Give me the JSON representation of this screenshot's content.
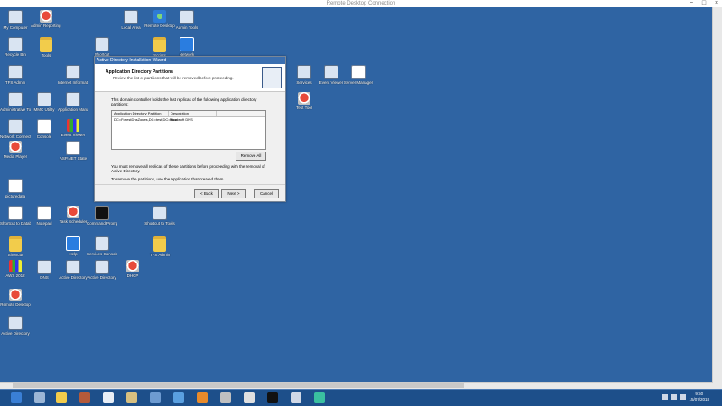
{
  "window": {
    "title": "Remote Desktop Connection",
    "controls": [
      "−",
      "□",
      "×"
    ]
  },
  "desktop": {
    "icons": [
      {
        "label": "My Computer",
        "glyph": "g-app"
      },
      {
        "label": "Admin Reporting Tool",
        "glyph": "g-red"
      },
      {
        "label": "Local Area",
        "glyph": "g-app"
      },
      {
        "label": "Remote Desktop",
        "glyph": "g-globe"
      },
      {
        "label": "Admin Tools",
        "glyph": "g-app"
      },
      {
        "label": "Recycle Bin",
        "glyph": "g-app"
      },
      {
        "label": "Tools",
        "glyph": "g-folder"
      },
      {
        "label": "Shortcut",
        "glyph": "g-app"
      },
      {
        "label": "Scripts",
        "glyph": "g-folder"
      },
      {
        "label": "Network",
        "glyph": "g-blue"
      },
      {
        "label": "TFS Admin",
        "glyph": "g-app"
      },
      {
        "label": "Internet Information",
        "glyph": "g-app"
      },
      {
        "label": "Service",
        "glyph": "g-purple"
      },
      {
        "label": "Administrative Tools",
        "glyph": "g-app"
      },
      {
        "label": "MMC Utility",
        "glyph": "g-app"
      },
      {
        "label": "Application Manager",
        "glyph": "g-app"
      },
      {
        "label": "Network Connections",
        "glyph": "g-app"
      },
      {
        "label": "Console",
        "glyph": "g-doc"
      },
      {
        "label": "Event Viewer",
        "glyph": "g-multi"
      },
      {
        "label": "Media Player",
        "glyph": "g-red"
      },
      {
        "label": "ASP.NET State",
        "glyph": "g-doc"
      },
      {
        "label": "picturedata",
        "glyph": "g-doc"
      },
      {
        "label": "Shortcut to Database",
        "glyph": "g-doc"
      },
      {
        "label": "Notepad",
        "glyph": "g-doc"
      },
      {
        "label": "Task Scheduler",
        "glyph": "g-red"
      },
      {
        "label": "Command Prompt",
        "glyph": "g-black"
      },
      {
        "label": "Shortcut to Tools",
        "glyph": "g-app"
      },
      {
        "label": "Shortcut",
        "glyph": "g-folder"
      },
      {
        "label": "Help",
        "glyph": "g-blue"
      },
      {
        "label": "Services Console",
        "glyph": "g-app"
      },
      {
        "label": "TFS Admin",
        "glyph": "g-folder"
      },
      {
        "label": "AWS 2012",
        "glyph": "g-multi"
      },
      {
        "label": "DNS",
        "glyph": "g-app"
      },
      {
        "label": "Active Directory",
        "glyph": "g-app"
      },
      {
        "label": "Active Directory",
        "glyph": "g-app"
      },
      {
        "label": "DHCP",
        "glyph": "g-red"
      },
      {
        "label": "Remote Desktop",
        "glyph": "g-red"
      },
      {
        "label": "Active Directory",
        "glyph": "g-app"
      },
      {
        "label": "Services",
        "glyph": "g-app"
      },
      {
        "label": "Event Viewer",
        "glyph": "g-app"
      },
      {
        "label": "Server Manager",
        "glyph": "g-doc"
      },
      {
        "label": "Test Tool",
        "glyph": "g-red"
      }
    ]
  },
  "dialog": {
    "title": "Active Directory Installation Wizard",
    "header_title": "Application Directory Partitions",
    "header_subtitle": "Review the list of partitions that will be removed before proceeding.",
    "description": "This domain controller holds the last replicas of the following application directory partitions:",
    "columns": [
      "Application Directory Partition",
      "Description"
    ],
    "rows": [
      [
        "DC=ForestDnsZones,DC=test,DC=local",
        "Microsoft DNS"
      ]
    ],
    "edit_button": "Remove All",
    "note1": "You must remove all replicas of these partitions before proceeding with the removal of Active Directory.",
    "note2": "To remove the partitions, use the application that created them.",
    "buttons": {
      "back": "< Back",
      "next": "Next >",
      "cancel": "Cancel"
    }
  },
  "taskbar": {
    "clock_time": "9:50",
    "clock_date": "15/07/2018"
  }
}
